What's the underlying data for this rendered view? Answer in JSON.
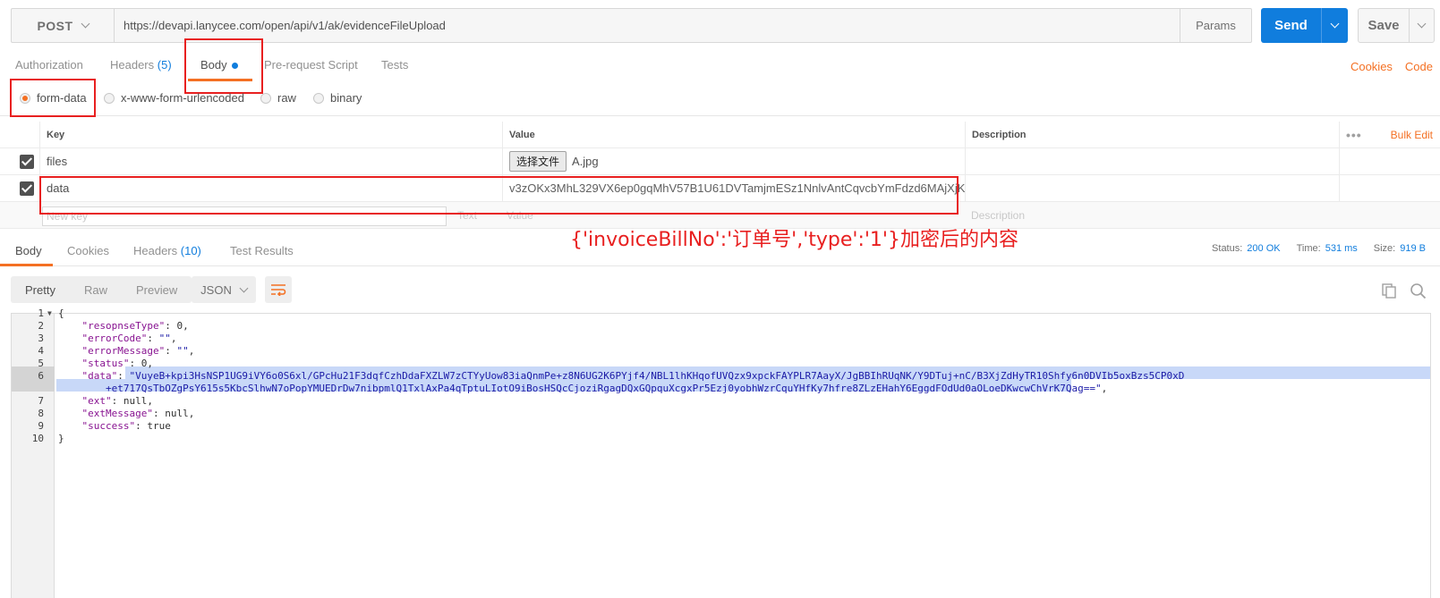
{
  "request": {
    "method": "POST",
    "url": "https://devapi.lanycee.com/open/api/v1/ak/evidenceFileUpload",
    "params_label": "Params",
    "send_label": "Send",
    "save_label": "Save"
  },
  "request_tabs": {
    "authorization": "Authorization",
    "headers": "Headers",
    "headers_count": "(5)",
    "body": "Body",
    "prerequest": "Pre-request Script",
    "tests": "Tests",
    "cookies_link": "Cookies",
    "code_link": "Code"
  },
  "body_types": {
    "form_data": "form-data",
    "urlencoded": "x-www-form-urlencoded",
    "raw": "raw",
    "binary": "binary",
    "selected": "form-data"
  },
  "kv_table": {
    "headers": {
      "key": "Key",
      "value": "Value",
      "description": "Description",
      "bulk_edit": "Bulk Edit"
    },
    "rows": [
      {
        "key": "files",
        "file_button": "选择文件",
        "value": "A.jpg",
        "checked": true
      },
      {
        "key": "data",
        "value": "v3zOKx3MhL329VX6ep0gqMhV57B1U61DVTamjmESz1NnlvAntCqvcbYmFdzd6MAjXjKDK...",
        "checked": true
      }
    ],
    "placeholder": {
      "key": "New key",
      "type": "Text",
      "value": "Value",
      "description": "Description"
    }
  },
  "annotation": "{'invoiceBillNo':'订单号','type':'1'}加密后的内容",
  "response_tabs": {
    "body": "Body",
    "cookies": "Cookies",
    "headers": "Headers",
    "headers_count": "(10)",
    "test_results": "Test Results"
  },
  "status": {
    "status_label": "Status:",
    "status_value": "200 OK",
    "time_label": "Time:",
    "time_value": "531 ms",
    "size_label": "Size:",
    "size_value": "919 B"
  },
  "view": {
    "pretty": "Pretty",
    "raw": "Raw",
    "preview": "Preview",
    "format": "JSON"
  },
  "response_json": {
    "line_numbers": [
      "1",
      "2",
      "3",
      "4",
      "5",
      "6",
      "7",
      "8",
      "9",
      "10"
    ],
    "open_brace": "{",
    "resopnseType_key": "\"resopnseType\"",
    "resopnseType_val": "0",
    "errorCode_key": "\"errorCode\"",
    "errorCode_val": "\"\"",
    "errorMessage_key": "\"errorMessage\"",
    "errorMessage_val": "\"\"",
    "status_key": "\"status\"",
    "status_val": "0",
    "data_key": "\"data\"",
    "data_val_1": "\"VuyeB+kpi3HsNSP1UG9iVY6o0S6xl/GPcHu21F3dqfCzhDdaFXZLW7zCTYyUow83iaQnmPe+z8N6UG2K6PYjf4/NBL1lhKHqofUVQzx9xpckFAYPLR7AayX/JgBBIhRUqNK/Y9DTuj+nC/B3XjZdHyTR10Shfy6n0DVIb5oxBzs5CP0xD",
    "data_val_2": "+et717QsTbOZgPsY615s5KbcSlhwN7oPopYMUEDrDw7nibpmlQ1TxlAxPa4qTptuLIotO9iBosHSQcCjoziRgagDQxGQpquXcgxPr5Ezj0yobhWzrCquYHfKy7hfre8ZLzEHahY6EggdFOdUd0aOLoeDKwcwChVrK7Qag==\"",
    "ext_key": "\"ext\"",
    "ext_val": "null",
    "extMessage_key": "\"extMessage\"",
    "extMessage_val": "null",
    "success_key": "\"success\"",
    "success_val": "true",
    "close_brace": "}"
  }
}
